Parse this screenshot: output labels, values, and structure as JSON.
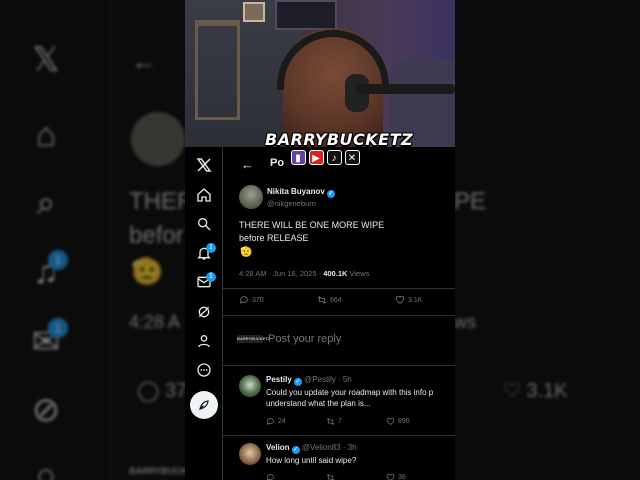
{
  "background": {
    "badges": [
      "1",
      "1"
    ],
    "heading_left": "THER",
    "heading_right": "PE",
    "line2": "befor",
    "time_fragment": "4:28 A",
    "views_fragment": "ws",
    "like_count": "3.1K",
    "reply_count": "37"
  },
  "stream": {
    "brand": "BARRYBUCKETZ",
    "socials": [
      "twitch-icon",
      "youtube-icon",
      "tiktok-icon",
      "x-icon"
    ]
  },
  "sidebar": {
    "notification_badge": "1",
    "messages_badge": "1"
  },
  "header": {
    "back_glyph": "←",
    "title": "Po"
  },
  "post": {
    "author_name": "Nikita Buyanov",
    "author_handle": "@nikgeneburn",
    "text_line1": "THERE WILL BE ONE MORE WIPE",
    "text_line2": "before RELEASE",
    "emoji": "🫡",
    "timestamp": "4:28 AM · Jun 16, 2025 · ",
    "views_count": "400.1K",
    "views_label": " Views",
    "replies": "370",
    "reposts": "664",
    "likes": "3.1K"
  },
  "composer": {
    "placeholder": "Post your reply",
    "logo_text": "BARRYBUCKETZ"
  },
  "replies": [
    {
      "name": "Pestily",
      "handle": "@Pestily · 5h",
      "line1": "Could you update your roadmap with this info p",
      "line2": "understand what the plan is...",
      "replies": "24",
      "reposts": "7",
      "likes": "890"
    },
    {
      "name": "Velion",
      "handle": "@Velion83 · 3h",
      "line1": "How long until said wipe?",
      "replies": "",
      "reposts": "",
      "likes": "36"
    }
  ],
  "colors": {
    "accent": "#1d9bf0",
    "background": "#000000",
    "muted": "#71767b",
    "text": "#e7e9ea"
  }
}
